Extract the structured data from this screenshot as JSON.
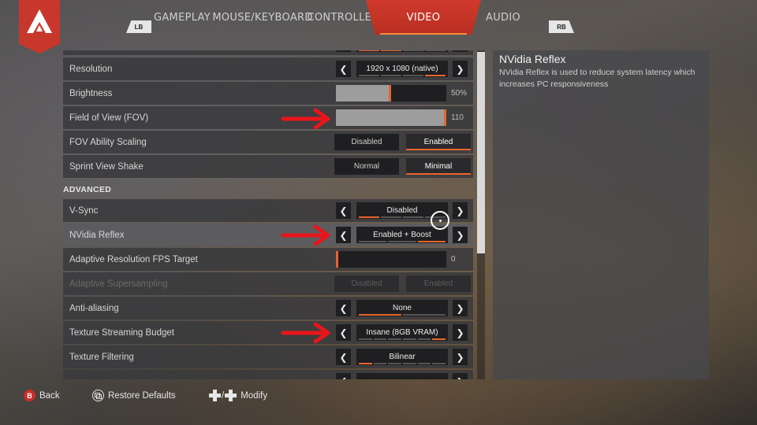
{
  "tabs": {
    "lb": "LB",
    "rb": "RB",
    "items": [
      "GAMEPLAY",
      "MOUSE/KEYBOARD",
      "CONTROLLER",
      "VIDEO",
      "AUDIO"
    ],
    "active": "VIDEO"
  },
  "settings": {
    "resolution": {
      "label": "Resolution",
      "value": "1920 x 1080 (native)",
      "bars": 4,
      "selected": 4
    },
    "brightness": {
      "label": "Brightness",
      "value_text": "50%",
      "level": 0.5
    },
    "fov": {
      "label": "Field of View (FOV)",
      "value_text": "110",
      "level": 1.0
    },
    "fov_scaling": {
      "label": "FOV Ability Scaling",
      "options": [
        "Disabled",
        "Enabled"
      ],
      "selected": "Enabled"
    },
    "sprint_shake": {
      "label": "Sprint View Shake",
      "options": [
        "Normal",
        "Minimal"
      ],
      "selected": "Minimal"
    },
    "advanced_header": "ADVANCED",
    "vsync": {
      "label": "V-Sync",
      "value": "Disabled",
      "bars": 4,
      "selected": 1
    },
    "nvidia_reflex": {
      "label": "NVidia Reflex",
      "value": "Enabled + Boost",
      "bars": 3,
      "selected": 3
    },
    "adaptive_fps": {
      "label": "Adaptive Resolution FPS Target",
      "value_text": "0",
      "level": 0
    },
    "adaptive_ss": {
      "label": "Adaptive Supersampling",
      "options": [
        "Disabled",
        "Enabled"
      ]
    },
    "anti_aliasing": {
      "label": "Anti-aliasing",
      "value": "None",
      "bars": 2,
      "selected": 1
    },
    "texture_budget": {
      "label": "Texture Streaming Budget",
      "value": "Insane (8GB VRAM)",
      "bars": 6,
      "selected": 6
    },
    "texture_filtering": {
      "label": "Texture Filtering",
      "value": "Bilinear",
      "bars": 6,
      "selected": 1
    }
  },
  "description": {
    "title": "NVidia Reflex",
    "text": "NVidia Reflex is used to reduce system latency which increases PC responsiveness"
  },
  "footer": {
    "back_glyph": "B",
    "back": "Back",
    "restore": "Restore Defaults",
    "modify_sep": "/",
    "modify": "Modify"
  },
  "colors": {
    "accent": "#e8652c",
    "brand_red": "#c8372b",
    "annotation_red": "#e8161b"
  }
}
